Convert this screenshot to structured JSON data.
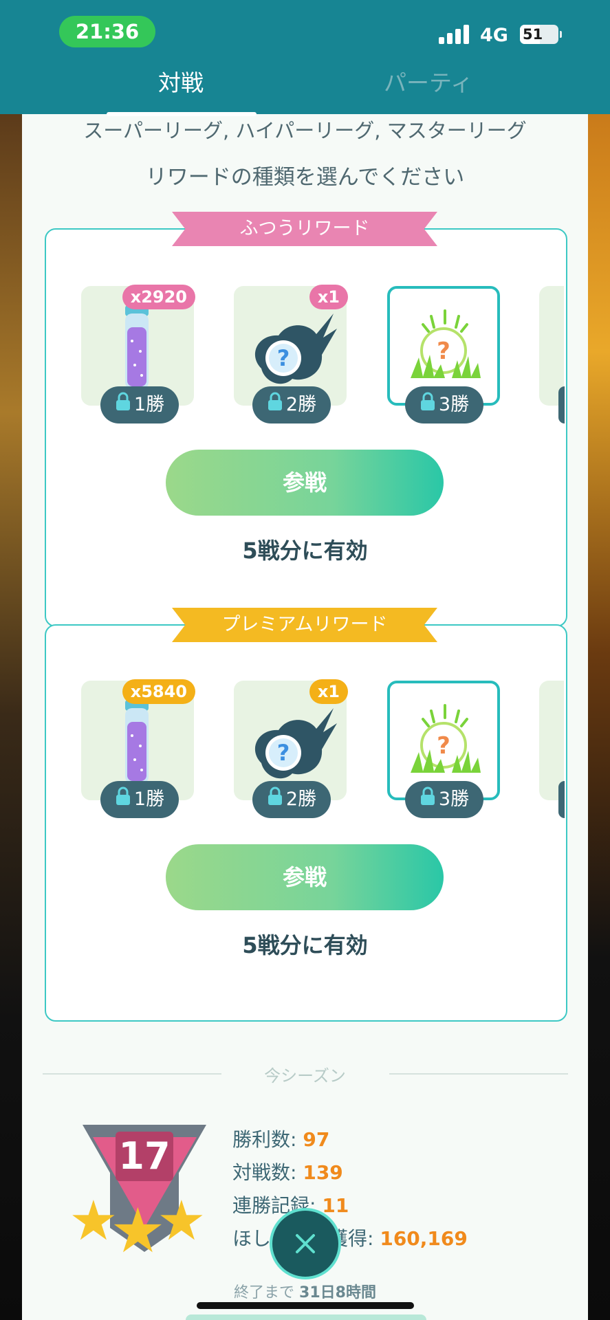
{
  "status_bar": {
    "time": "21:36",
    "network": "4G",
    "battery": "51"
  },
  "tabs": [
    {
      "label": "対戦",
      "active": true
    },
    {
      "label": "パーティ",
      "active": false
    }
  ],
  "leagues_text": "スーパーリーグ, ハイパーリーグ, マスターリーグ",
  "instruction": "リワードの種類を選んでください",
  "normal_reward": {
    "title": "ふつうリワード",
    "items": [
      {
        "icon": "stardust-vial-icon",
        "quantity": "x2920",
        "wins": "1勝"
      },
      {
        "icon": "mystery-fast-tm-icon",
        "quantity": "x1",
        "wins": "2勝"
      },
      {
        "icon": "mystery-encounter-grass-icon",
        "quantity": "",
        "wins": "3勝"
      }
    ],
    "button": "参戦",
    "validity": "5戦分に有効"
  },
  "premium_reward": {
    "title": "プレミアムリワード",
    "items": [
      {
        "icon": "stardust-vial-icon",
        "quantity": "x5840",
        "wins": "1勝"
      },
      {
        "icon": "mystery-fast-tm-icon",
        "quantity": "x1",
        "wins": "2勝"
      },
      {
        "icon": "mystery-encounter-grass-icon",
        "quantity": "",
        "wins": "3勝"
      }
    ],
    "button": "参戦",
    "validity": "5戦分に有効"
  },
  "season": {
    "label": "今シーズン",
    "rank": "17",
    "stats": [
      {
        "label": "勝利数: ",
        "value": "97"
      },
      {
        "label": "対戦数: ",
        "value": "139"
      },
      {
        "label": "連勝記録: ",
        "value": "11"
      },
      {
        "label": "ほしのすな獲得: ",
        "value": "160,169"
      }
    ],
    "end_prefix": "終了まで ",
    "end_value": "31日8時間"
  },
  "colors": {
    "teal": "#178593",
    "pink": "#e985b2",
    "gold": "#f4ba22",
    "accent_orange": "#f08a1c"
  }
}
